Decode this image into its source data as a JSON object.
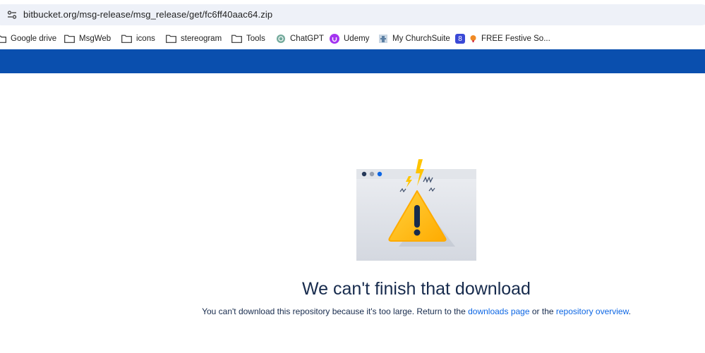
{
  "browser": {
    "url": "bitbucket.org/msg-release/msg_release/get/fc6ff40aac64.zip",
    "site_info_icon": "tune-icon"
  },
  "bookmarks": [
    {
      "label": "Google drive",
      "icon": "folder-icon"
    },
    {
      "label": "MsgWeb",
      "icon": "folder-icon"
    },
    {
      "label": "icons",
      "icon": "folder-icon"
    },
    {
      "label": "stereogram",
      "icon": "folder-icon"
    },
    {
      "label": "Tools",
      "icon": "folder-icon"
    },
    {
      "label": "ChatGPT",
      "icon": "chatgpt-icon"
    },
    {
      "label": "Udemy",
      "icon": "udemy-icon"
    },
    {
      "label": "My ChurchSuite",
      "icon": "churchsuite-icon"
    },
    {
      "label": "FREE Festive So...",
      "icon": "festive-icon"
    }
  ],
  "header": {
    "color": "#0a4fae"
  },
  "error": {
    "title": "We can't finish that download",
    "message_prefix": "You can't download this repository because it's too large. Return to the ",
    "downloads_link": "downloads page",
    "message_middle": " or the ",
    "overview_link": "repository overview",
    "message_suffix": ".",
    "illustration_icon": "warning-triangle-icon"
  },
  "colors": {
    "link": "#0c66e4",
    "heading": "#172b4d",
    "warning": "#ffab00"
  }
}
